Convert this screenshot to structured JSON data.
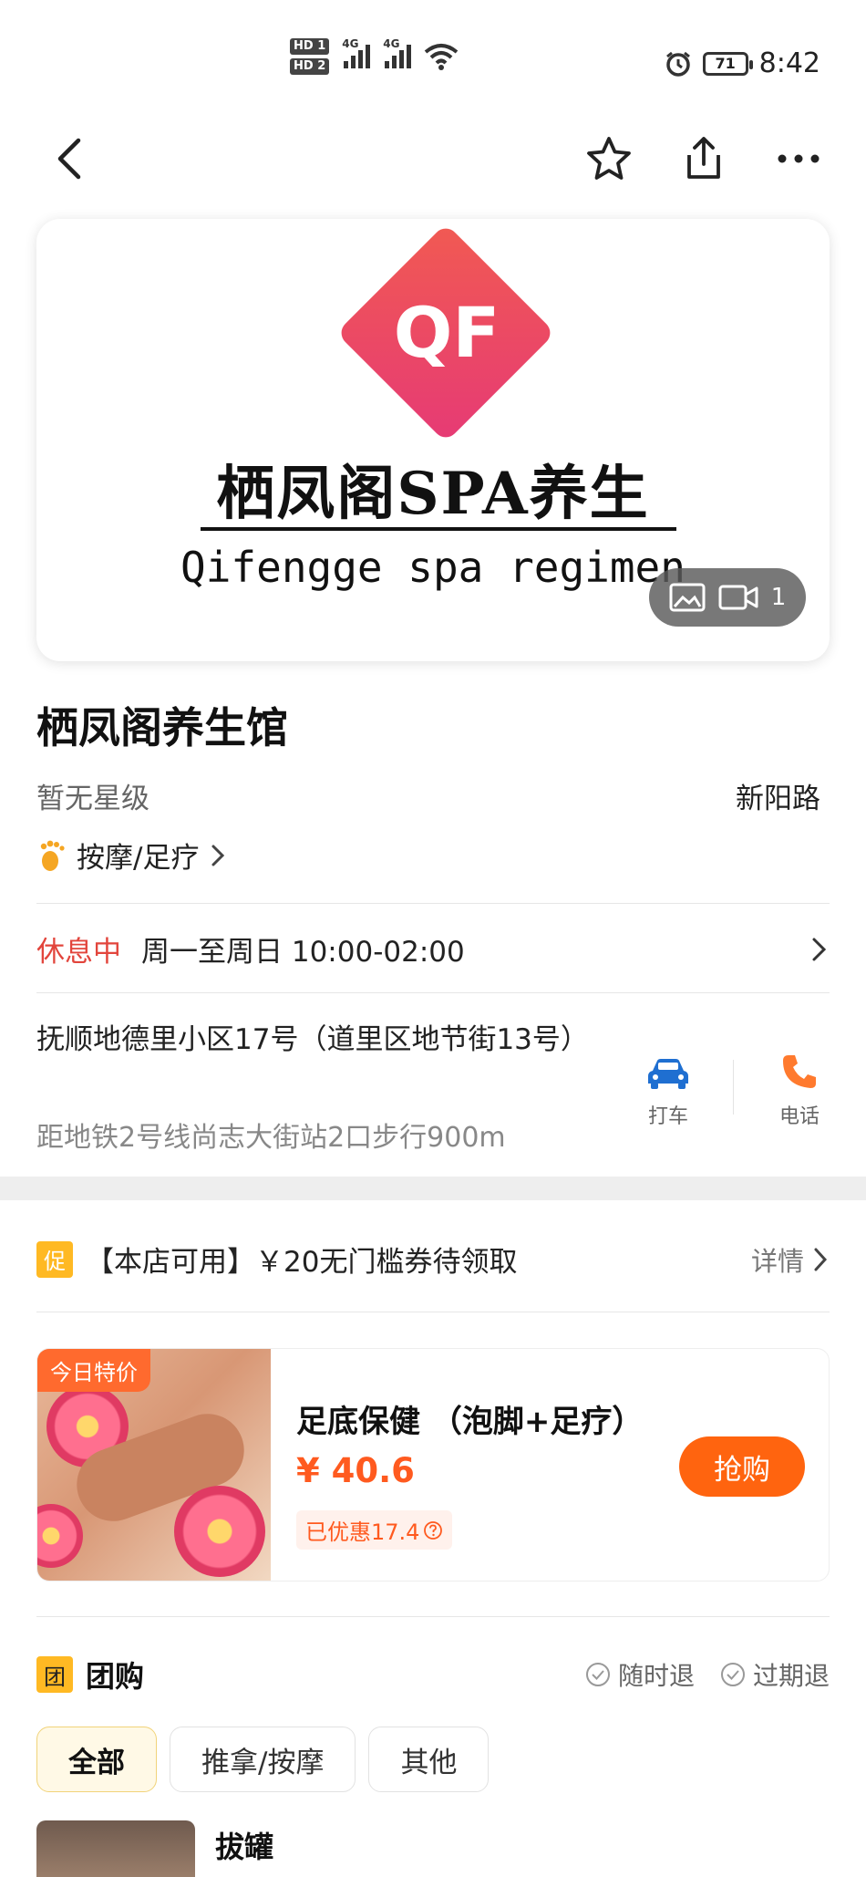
{
  "status_bar": {
    "sim1": "HD 1",
    "sim2": "HD 2",
    "net1": "4G",
    "net2": "4G",
    "battery": "71",
    "time": "8:42"
  },
  "nav": {
    "back_icon": "chevron-left-icon",
    "favorite_icon": "star-outline-icon",
    "share_icon": "share-icon",
    "more_icon": "more-dots-icon"
  },
  "hero": {
    "logo_mark": "QF",
    "logo_cn": "栖凤阁SPA养生",
    "logo_en": "Qifengge spa regimen",
    "media_count": "1"
  },
  "shop": {
    "name": "栖凤阁养生馆",
    "star_level": "暂无星级",
    "area": "新阳路",
    "category": "按摩/足疗",
    "status": "休息中",
    "hours": "周一至周日 10:00-02:00",
    "address": "抚顺地德里小区17号（道里区地节街13号）",
    "subway": "距地铁2号线尚志大街站2口步行900m",
    "taxi_label": "打车",
    "phone_label": "电话"
  },
  "promo": {
    "badge": "促",
    "text": "【本店可用】￥20无门槛券待领取",
    "more": "详情"
  },
  "deal": {
    "tag": "今日特价",
    "name": "足底保健 （泡脚+足疗）",
    "price": "¥ 40.6",
    "discount": "已优惠17.4",
    "buy_label": "抢购"
  },
  "group": {
    "badge": "团",
    "title": "团购",
    "policy_1": "随时退",
    "policy_2": "过期退",
    "chips": [
      "全部",
      "推拿/按摩",
      "其他"
    ],
    "first_item": "拔罐"
  },
  "colors": {
    "accent_orange": "#ff640f",
    "status_red": "#e2453c",
    "badge_yellow": "#ffb923",
    "taxi_blue": "#1f6fd1",
    "phone_orange": "#ff7a2e"
  }
}
